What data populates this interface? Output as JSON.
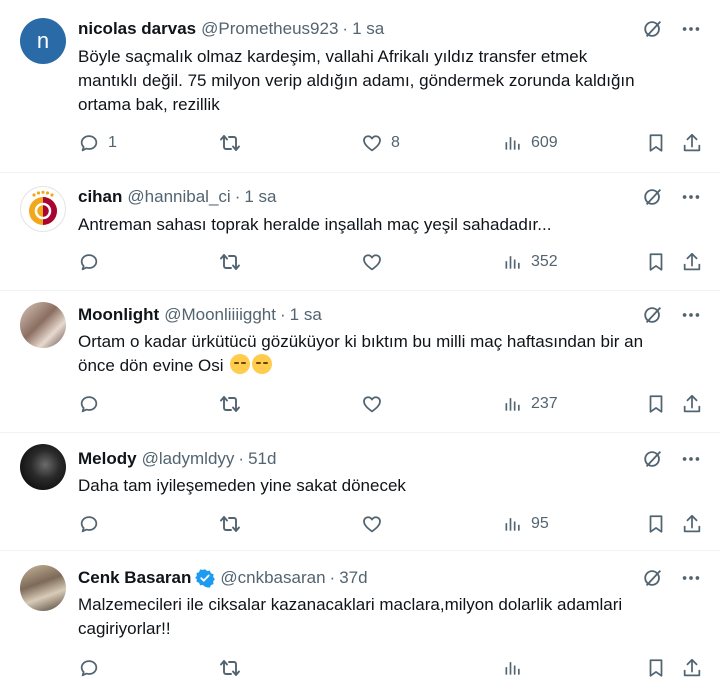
{
  "tweets": [
    {
      "name": "nicolas darvas",
      "handle": "@Prometheus923",
      "time": "1 sa",
      "avatar_letter": "n",
      "text_lines": [
        "Böyle saçmalık olmaz kardeşim, vallahi Afrikalı yıldız transfer etmek",
        "mantıklı değil. 75 milyon verip aldığın adamı, göndermek zorunda kaldığın",
        "ortama bak, rezillik"
      ],
      "replies": "1",
      "retweets": "",
      "likes": "8",
      "views": "609"
    },
    {
      "name": "cihan",
      "handle": "@hannibal_ci",
      "time": "1 sa",
      "text_lines": [
        "Antreman sahası toprak heralde inşallah maç yeşil sahadadır..."
      ],
      "replies": "",
      "retweets": "",
      "likes": "",
      "views": "352"
    },
    {
      "name": "Moonlight",
      "handle": "@Moonliiiigght",
      "time": "1 sa",
      "text_lines": [
        "Ortam o kadar ürkütücü gözüküyor ki bıktım bu milli maç haftasından bir an",
        "önce dön evine Osi"
      ],
      "replies": "",
      "retweets": "",
      "likes": "",
      "views": "237"
    },
    {
      "name": "Melody",
      "handle": "@ladymldyy",
      "time": "51d",
      "text_lines": [
        "Daha tam iyileşemeden yine sakat dönecek"
      ],
      "replies": "",
      "retweets": "",
      "likes": "",
      "views": "95"
    },
    {
      "name": "Cenk Basaran",
      "handle": "@cnkbasaran",
      "time": "37d",
      "verified": true,
      "text_lines": [
        "Malzemecileri ile ciksalar kazanacaklari maclara,milyon dolarlik adamlari",
        "cagiriyorlar!!"
      ],
      "replies": "",
      "retweets": "",
      "likes": "",
      "views": ""
    }
  ],
  "header_separator": "·",
  "icons": {
    "top": [
      "grok-icon",
      "more-icon"
    ],
    "actions": [
      "reply-icon",
      "retweet-icon",
      "like-icon",
      "views-icon",
      "bookmark-icon",
      "share-icon"
    ]
  },
  "colors": {
    "text": "#0f1419",
    "secondary": "#536471",
    "verified": "#1d9bf0",
    "divider": "#eff3f4"
  }
}
